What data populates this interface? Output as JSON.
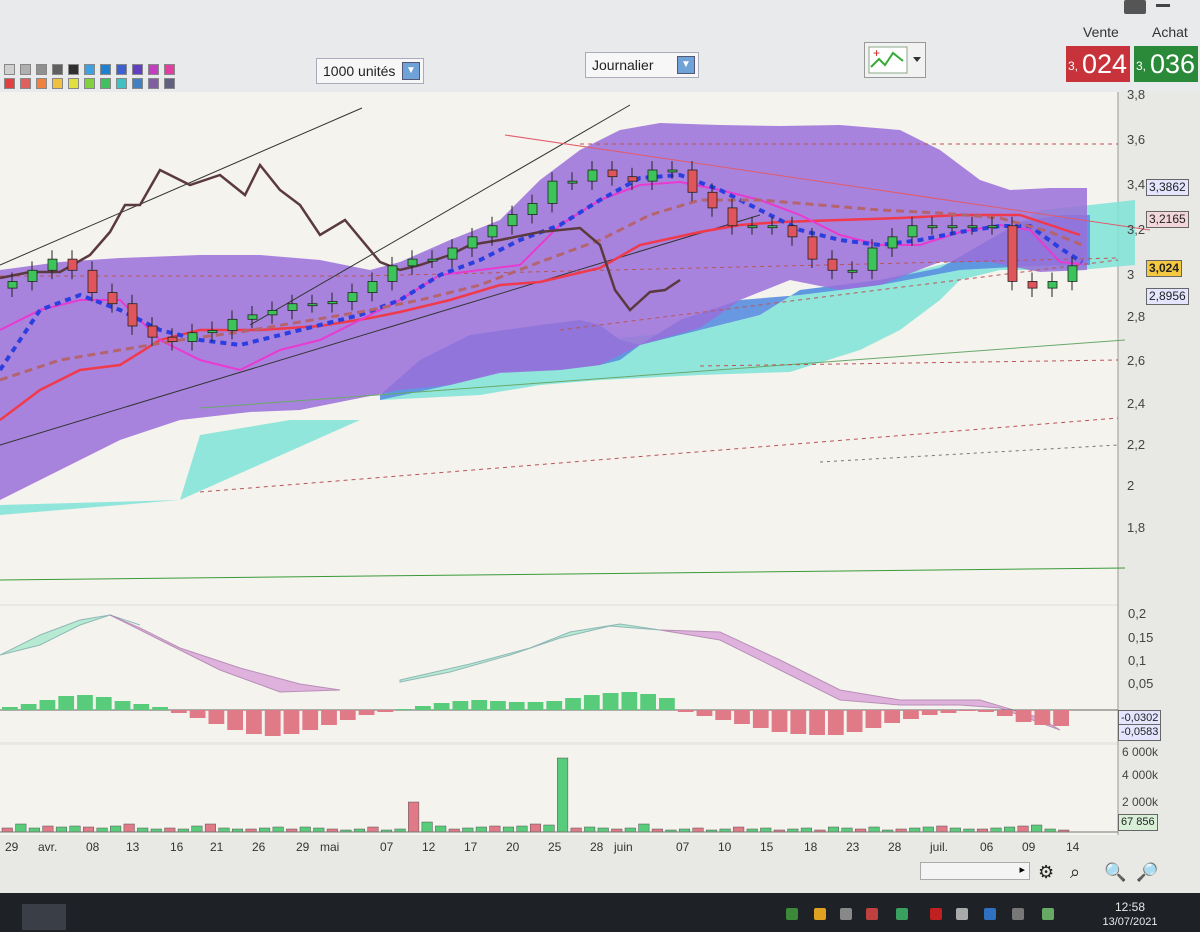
{
  "toolbar": {
    "quantity_select": "1000 unités",
    "period_select": "Journalier",
    "sell_label": "Vente",
    "buy_label": "Achat",
    "sell_price_prefix": "3,",
    "sell_price_main": "024",
    "buy_price_prefix": "3,",
    "buy_price_main": "036"
  },
  "price_axis": {
    "ticks": [
      "3,8",
      "3,6",
      "3,4",
      "3,2",
      "3",
      "2,8",
      "2,6",
      "2,4",
      "2,2",
      "2",
      "1,8"
    ],
    "tags": [
      "3,3862",
      "3,2165",
      "3,024",
      "2,8956"
    ]
  },
  "macd_axis": {
    "ticks": [
      "0,2",
      "0,15",
      "0,1",
      "0,05"
    ],
    "tags": [
      "-0,0302",
      "-0,0583"
    ]
  },
  "volume_axis": {
    "ticks": [
      "6 000k",
      "4 000k",
      "2 000k"
    ],
    "tags": [
      "67 856"
    ]
  },
  "date_axis": {
    "labels": [
      "29",
      "avr.",
      "08",
      "13",
      "16",
      "21",
      "26",
      "29",
      "mai",
      "07",
      "12",
      "17",
      "20",
      "25",
      "28",
      "juin",
      "07",
      "10",
      "15",
      "18",
      "23",
      "28",
      "juil.",
      "06",
      "09",
      "14"
    ]
  },
  "taskbar": {
    "time": "12:58",
    "date": "13/07/2021"
  },
  "colors": {
    "cloud_purple": "#9a6fd9",
    "cloud_cyan": "#7fe3d8",
    "cloud_blue": "#5a8ee0",
    "ma_red": "#f03a4c",
    "ma_pink": "#e83ad0",
    "ma_blue_dotted": "#2b3fe0",
    "ma_brown_dashed": "#b4646e",
    "chikou": "#5a3a3e",
    "candle_up": "#3cc35a",
    "candle_down": "#e0545c",
    "sell_red": "#c8323a",
    "buy_green": "#2a8a3a"
  },
  "chart_data": {
    "type": "candlestick",
    "instrument_quote": {
      "sell": "3,024",
      "buy": "3,036"
    },
    "period": "Journalier",
    "candles_close_approx": [
      2.95,
      3.0,
      3.05,
      3.0,
      2.9,
      2.85,
      2.75,
      2.7,
      2.68,
      2.72,
      2.73,
      2.78,
      2.8,
      2.82,
      2.85,
      2.85,
      2.86,
      2.9,
      2.95,
      3.02,
      3.05,
      3.05,
      3.1,
      3.15,
      3.2,
      3.25,
      3.3,
      3.4,
      3.4,
      3.45,
      3.42,
      3.4,
      3.45,
      3.45,
      3.35,
      3.28,
      3.2,
      3.2,
      3.2,
      3.15,
      3.05,
      3.0,
      3.0,
      3.1,
      3.15,
      3.2,
      3.2,
      3.2,
      3.2,
      3.2,
      2.95,
      2.92,
      2.95,
      3.02
    ],
    "ylim": [
      1.7,
      3.8
    ],
    "macd_ylim": [
      -0.07,
      0.22
    ],
    "volume_ylim": [
      0,
      6500
    ]
  }
}
